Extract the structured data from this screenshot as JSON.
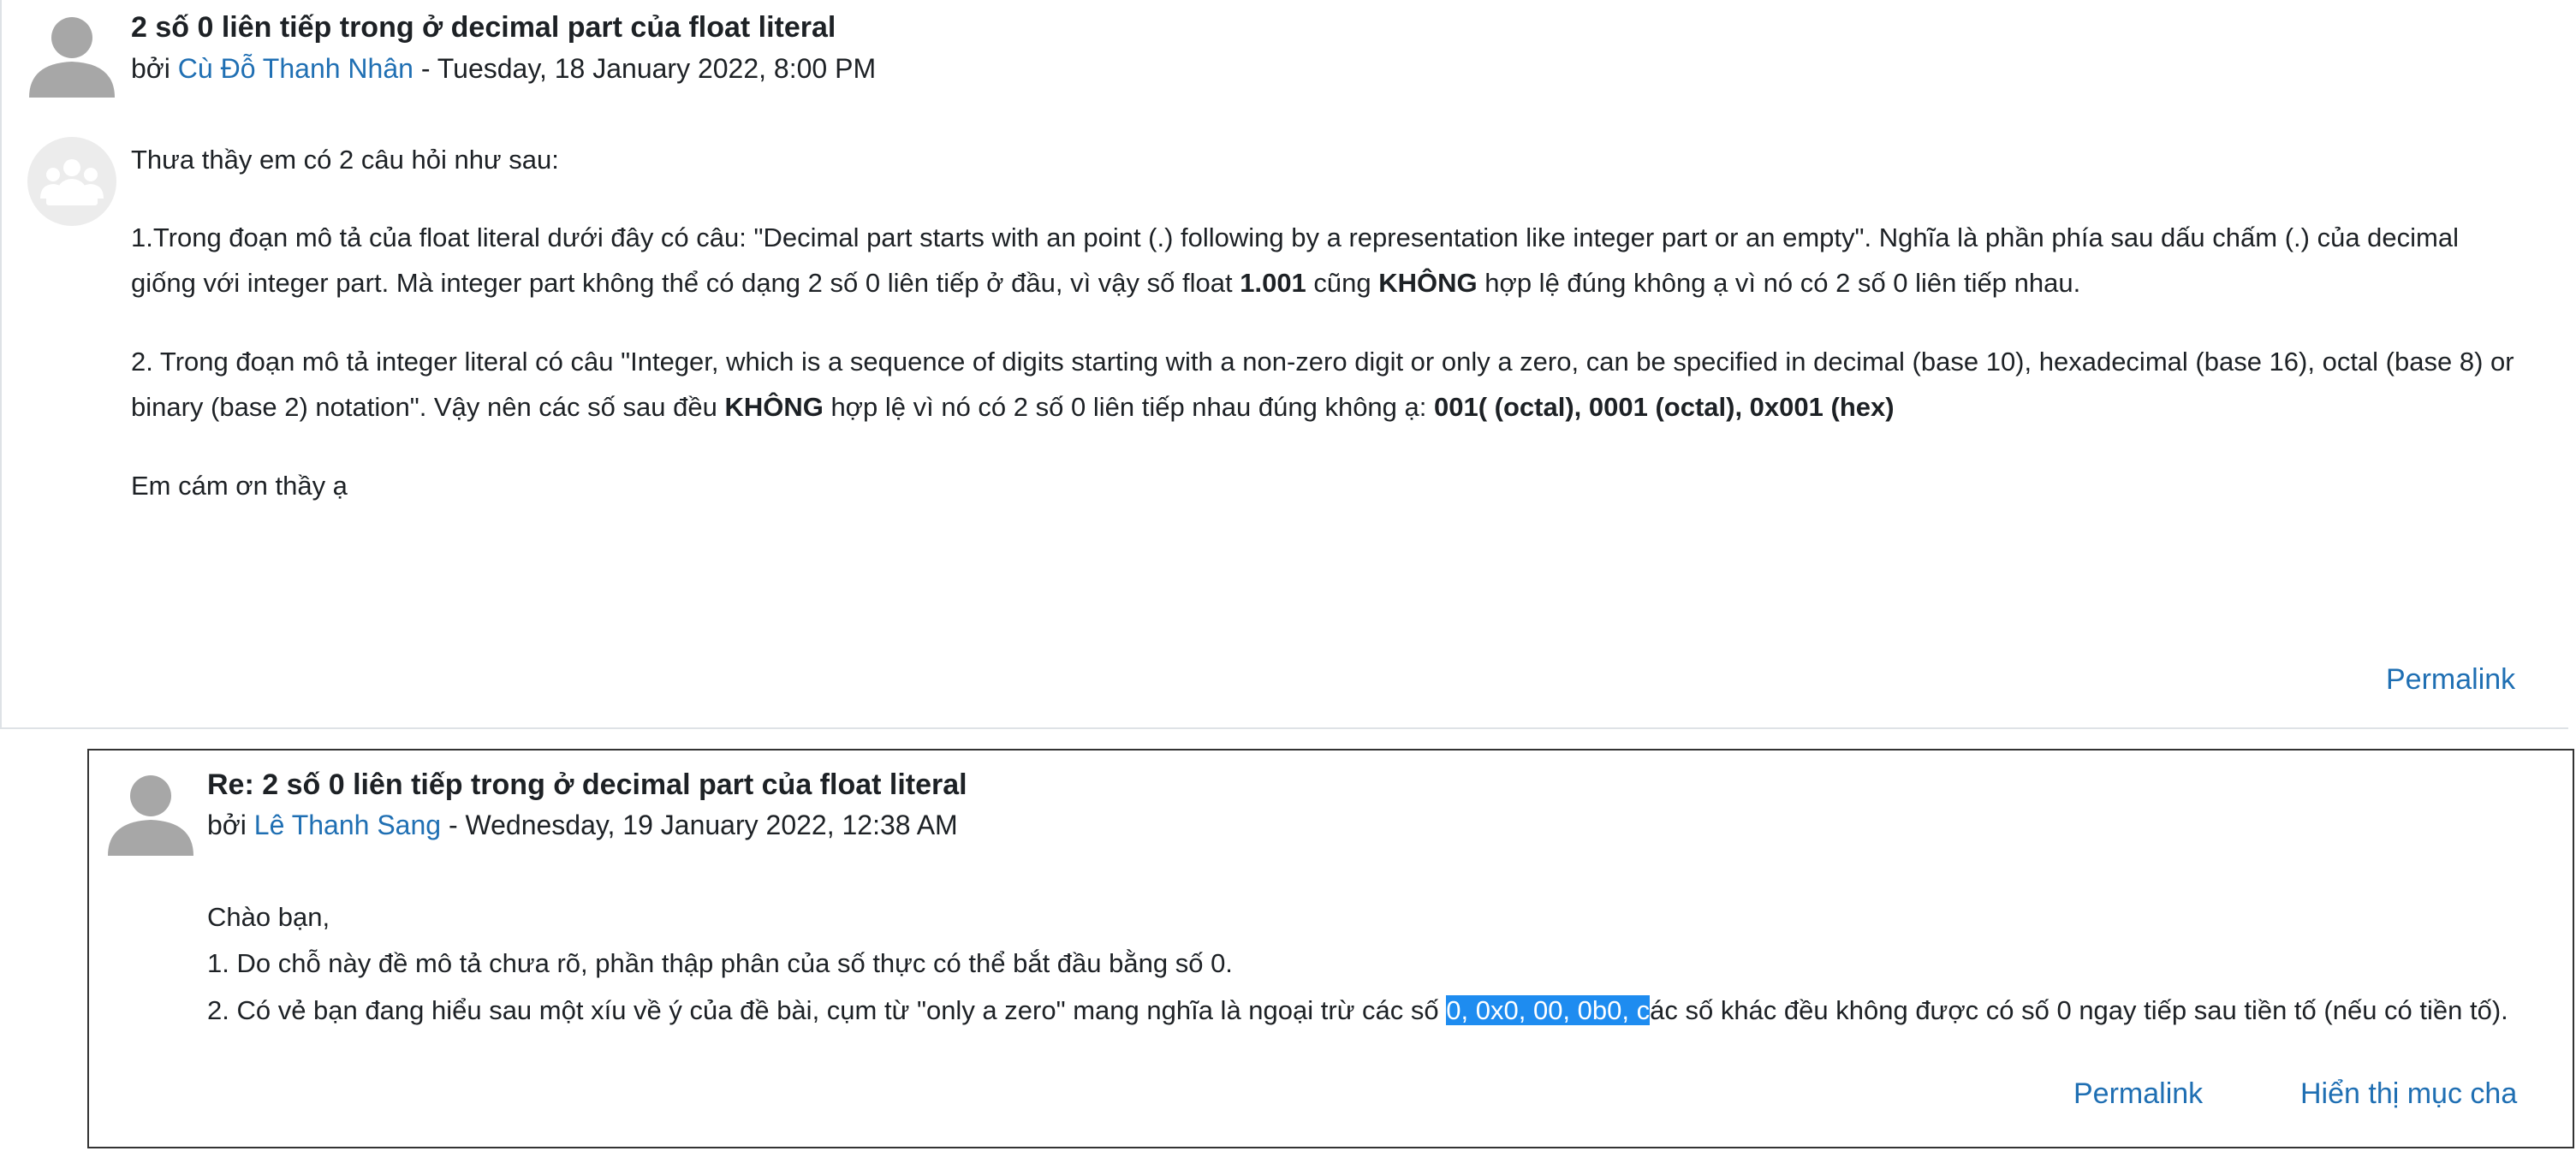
{
  "posts": [
    {
      "title": "2 số 0 liên tiếp trong ở decimal part của float literal",
      "by": "bởi",
      "author": "Cù Đỗ Thanh Nhân",
      "date": " - Tuesday, 18 January 2022, 8:00 PM",
      "greeting": "Thưa thầy em có 2 câu hỏi như sau:",
      "q1_line1": "1.Trong đoạn mô tả của float literal dưới đây có câu: \"Decimal part starts with an point (.) following by a representation like integer part or an empty\". Nghĩa là phần phía sau dấu chấm (.) của decimal",
      "q1_line2_a": "giống với integer part. Mà integer part không thể có dạng 2 số 0 liên tiếp ở đầu, vì vậy số float ",
      "q1_line2_b": "1.001",
      "q1_line2_c": " cũng ",
      "q1_line2_d": "KHÔNG",
      "q1_line2_e": " hợp lệ đúng không ạ vì nó có 2 số 0 liên tiếp nhau.",
      "q2_line1": "2. Trong đoạn mô tả integer literal có câu \"Integer, which is a sequence of digits starting with a non-zero digit or only a zero, can be specified in decimal (base 10), hexadecimal (base 16), octal (base 8) or",
      "q2_line2_a": "binary (base 2) notation\". Vậy nên các số sau đều ",
      "q2_line2_b": "KHÔNG",
      "q2_line2_c": " hợp lệ vì nó có 2 số 0 liên tiếp nhau đúng không ạ: ",
      "q2_line2_d": "001(  (octal), 0001 (octal), 0x001 (hex)",
      "thanks": "Em cám ơn thầy ạ",
      "permalink": "Permalink"
    },
    {
      "title": "Re: 2 số 0 liên tiếp trong ở decimal part của float literal",
      "by": "bởi",
      "author": "Lê Thanh Sang",
      "date": " - Wednesday, 19 January 2022, 12:38 AM",
      "line1": "Chào bạn,",
      "line2": "1. Do chỗ này đề mô tả chưa rõ, phần thập phân của số thực có thể bắt đầu bằng số 0.",
      "line3_a": "2. Có vẻ bạn đang hiểu sau một xíu về ý của đề bài, cụm từ \"only a zero\" mang nghĩa là ngoại trừ các số ",
      "line3_sel": "0, 0x0, 00, 0b0, c",
      "line3_b": "ác số khác đều không được có số 0 ngay tiếp sau tiền tố (nếu có tiền tố).",
      "permalink": "Permalink",
      "show_parent": "Hiển thị mục cha"
    }
  ]
}
